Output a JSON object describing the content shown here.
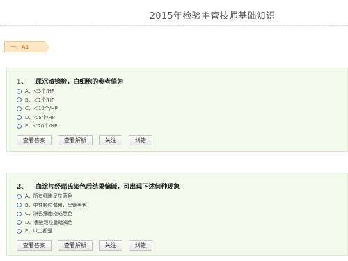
{
  "page": {
    "title": "2015年检验主管技师基础知识"
  },
  "section": {
    "label": "一、A1"
  },
  "questions": [
    {
      "number": "1、",
      "text": "尿沉渣镜检，白细胞的参考值为",
      "options": [
        "A、＜3个/HP",
        "B、＜1个/HP",
        "C、＜10个/HP",
        "D、＜5个/HP",
        "E、＜20个/HP"
      ]
    },
    {
      "number": "2、",
      "text": "血涂片经瑞氏染色后结果偏碱，可出现下述何种现象",
      "options": [
        "A、所有细胞呈灰蓝色",
        "B、中性颗粒偏粗，呈紫黑色",
        "C、淋巴细胞染成黑色",
        "D、嗜酸颗粒呈暗褐色",
        "E、以上都是"
      ]
    }
  ],
  "buttons": {
    "answer": "查看答案",
    "analysis": "查看解析",
    "follow": "关注",
    "correct": "纠错"
  }
}
